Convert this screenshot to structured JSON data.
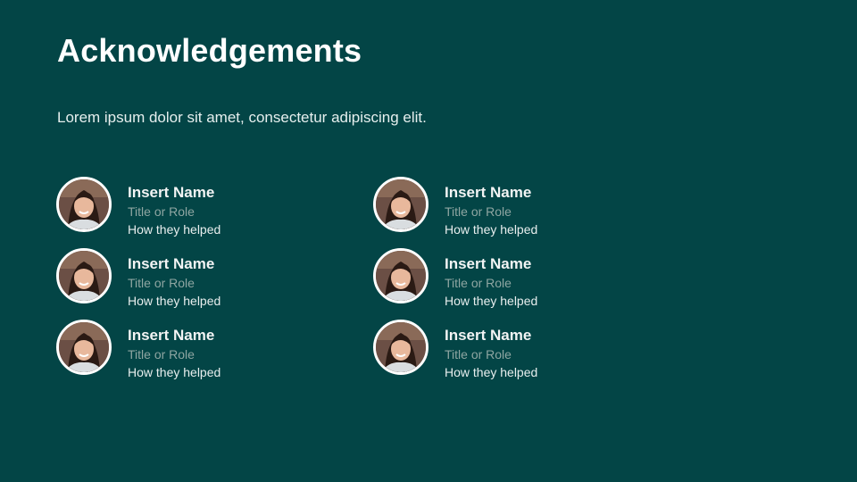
{
  "slide": {
    "title": "Acknowledgements",
    "subtitle": "Lorem ipsum dolor sit amet, consectetur adipiscing elit."
  },
  "people": [
    {
      "name": "Insert Name",
      "role": "Title or Role",
      "helped": "How they helped",
      "avatar_icon": "person-photo"
    },
    {
      "name": "Insert Name",
      "role": "Title or Role",
      "helped": "How they helped",
      "avatar_icon": "person-photo"
    },
    {
      "name": "Insert Name",
      "role": "Title or Role",
      "helped": "How they helped",
      "avatar_icon": "person-photo"
    },
    {
      "name": "Insert Name",
      "role": "Title or Role",
      "helped": "How they helped",
      "avatar_icon": "person-photo"
    },
    {
      "name": "Insert Name",
      "role": "Title or Role",
      "helped": "How they helped",
      "avatar_icon": "person-photo"
    },
    {
      "name": "Insert Name",
      "role": "Title or Role",
      "helped": "How they helped",
      "avatar_icon": "person-photo"
    }
  ],
  "colors": {
    "background": "#034546",
    "title": "#ffffff",
    "role_text": "#8fa6a2"
  }
}
